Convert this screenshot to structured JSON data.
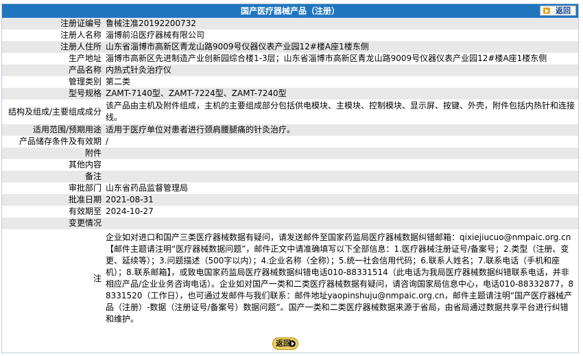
{
  "header": {
    "title": "国产医疗器械产品（注册）",
    "back_label": "返回"
  },
  "fields": [
    {
      "label": "注册证编号",
      "value": "鲁械注准20192200732"
    },
    {
      "label": "注册人名称",
      "value": "淄博前沿医疗器械有限公司"
    },
    {
      "label": "注册人住所",
      "value": "山东省淄博市高新区青龙山路9009号仪器仪表产业园12#楼A座1楼东侧"
    },
    {
      "label": "生产地址",
      "value": "淄博市高新区先进制造产业创新园综合楼1-3层；山东省淄博市高新区青龙山路9009号仪器仪表产业园12#楼A座1楼东侧"
    },
    {
      "label": "产品名称",
      "value": "内热式针灸治疗仪"
    },
    {
      "label": "管理类别",
      "value": "第二类"
    },
    {
      "label": "型号规格",
      "value": "ZAMT-7140型、ZAMT-7224型、ZAMT-7240型"
    },
    {
      "label": "结构及组成/主要组成成分",
      "value": "该产品由主机及附件组成，主机的主要组成部分包括供电模块、主模块、控制模块、显示屏、按键、外壳，附件包括内热针和连接线。"
    },
    {
      "label": "适用范围/预期用途",
      "value": "适用于医疗单位对患者进行颈肩腰腿痛的针灸治疗。"
    },
    {
      "label": "产品储存条件及有效期",
      "value": "/"
    },
    {
      "label": "附件",
      "value": ""
    },
    {
      "label": "其他内容",
      "value": ""
    },
    {
      "label": "备注",
      "value": ""
    },
    {
      "label": "审批部门",
      "value": "山东省药品监督管理局"
    },
    {
      "label": "批准日期",
      "value": "2021-08-31"
    },
    {
      "label": "有效期至",
      "value": "2024-10-27"
    },
    {
      "label": "变更情况",
      "value": ""
    }
  ],
  "note": {
    "label": "注",
    "text": "企业如对进口和国产三类医疗器械数据有疑问，请发送邮件至国家药监局医疗器械数据纠错邮箱：qixiejiucuo@nmpaic.org.cn【邮件主题请注明“医疗器械数据问题”，邮件正文中请准确填写以下全部信息：1.医疗器械注册证号/备案号；2.类型（注册、变更、延续等）；3.问题描述（500字以内）；4.企业名称（全称）；5.统一社会信用代码；6.联系人姓名；7.联系电话（手机和座机）；8.联系邮箱】，或致电国家药监局医疗器械数据纠错电话010-88331514（此电话为我局医疗器械数据纠错联系电话，并非相应产品/企业业务咨询电话）。企业如对国产一类和二类医疗器械数据有疑问，请咨询国家局信息中心，电话010-88332877，88331520（工作日），也可通过发邮件与我们联系：邮件地址yaopinshuju@nmpaic.org.cn，邮件主题请注明“国产医疗器械产品（注册）-数据（注册证号/备案号）数据问题”。国产一类和二类医疗器械数据来源于省局，由省局通过数据共享平台进行纠错和维护。"
  },
  "footer": {
    "back_label": "返回"
  },
  "colors": {
    "header_bg": "#1f76bf",
    "row_alt_bg": "#e8e8e8"
  }
}
